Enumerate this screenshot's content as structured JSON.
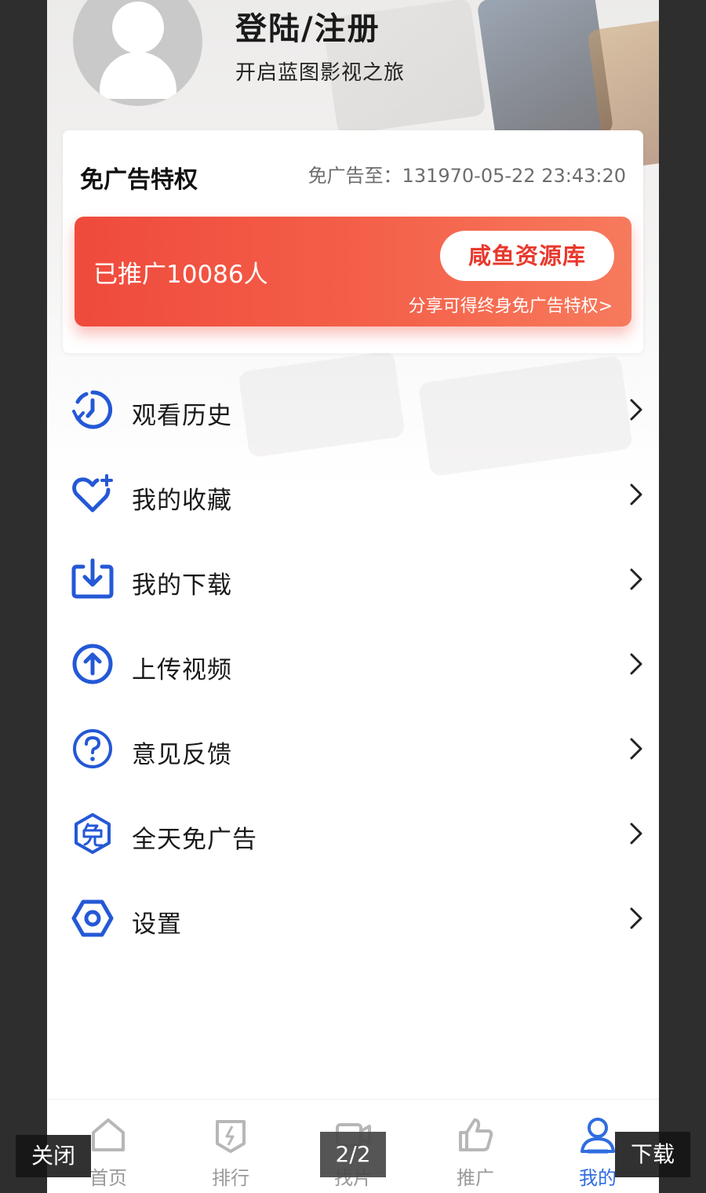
{
  "header": {
    "login_title": "登陆/注册",
    "login_subtitle": "开启蓝图影视之旅"
  },
  "ad_free": {
    "title": "免广告特权",
    "expire_text": "免广告至：131970-05-22 23:43:20"
  },
  "promo": {
    "count_text": "已推广10086人",
    "button_label": "咸鱼资源库",
    "share_text": "分享可得终身免广告特权>"
  },
  "menu": [
    {
      "label": "观看历史",
      "icon": "history-icon"
    },
    {
      "label": "我的收藏",
      "icon": "favorite-heart-icon"
    },
    {
      "label": "我的下载",
      "icon": "download-icon"
    },
    {
      "label": "上传视频",
      "icon": "upload-icon"
    },
    {
      "label": "意见反馈",
      "icon": "feedback-question-icon"
    },
    {
      "label": "全天免广告",
      "icon": "ad-free-badge-icon"
    },
    {
      "label": "设置",
      "icon": "settings-hex-icon"
    }
  ],
  "tabbar": [
    {
      "label": "首页",
      "icon": "home-icon",
      "active": false
    },
    {
      "label": "排行",
      "icon": "ranking-icon",
      "active": false
    },
    {
      "label": "找片",
      "icon": "find-video-icon",
      "active": false
    },
    {
      "label": "推广",
      "icon": "thumbs-up-icon",
      "active": false
    },
    {
      "label": "我的",
      "icon": "profile-icon",
      "active": true
    }
  ],
  "viewer": {
    "close_label": "关闭",
    "page_indicator": "2/2",
    "download_label": "下载"
  },
  "colors": {
    "accent_blue": "#2f6de0",
    "promo_red": "#ef4a3c",
    "icon_blue": "#2458d6"
  }
}
